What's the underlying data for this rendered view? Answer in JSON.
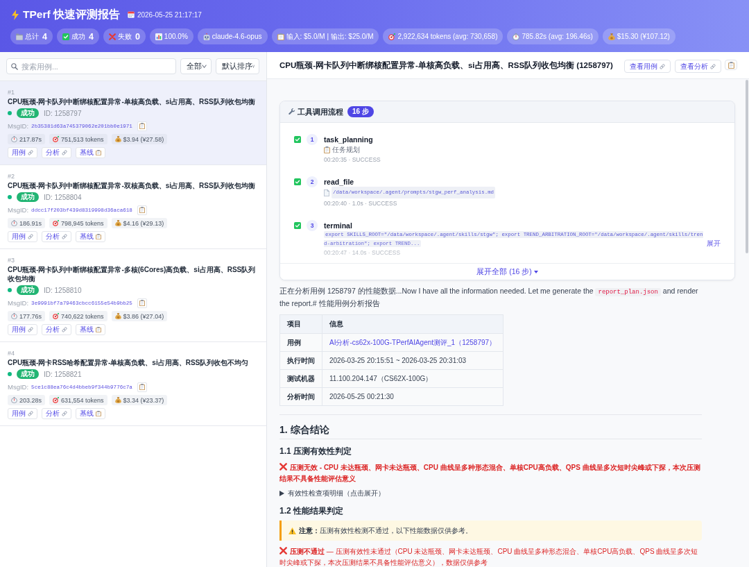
{
  "header": {
    "title": "TPerf 快速评测报告",
    "timestamp": "2026-05-25 21:17:17",
    "stats": [
      {
        "kind": "total",
        "label": "总计",
        "value": "4"
      },
      {
        "kind": "success",
        "label": "成功",
        "value": "4"
      },
      {
        "kind": "failed",
        "label": "失败",
        "value": "0"
      },
      {
        "kind": "rate",
        "label": "100.0%"
      },
      {
        "kind": "model",
        "label": "claude-4.6-opus"
      },
      {
        "kind": "price",
        "label": "输入: $5.0/M | 输出: $25.0/M"
      },
      {
        "kind": "tokens",
        "label": "2,922,634 tokens (avg: 730,658)"
      },
      {
        "kind": "time",
        "label": "785.82s (avg: 196.46s)"
      },
      {
        "kind": "cost",
        "label": "$15.30 (¥107.12)"
      }
    ]
  },
  "sidebar": {
    "search": {
      "placeholder": "搜索用例..."
    },
    "status_filter": {
      "value": "全部"
    },
    "sort": {
      "value": "默认排序"
    },
    "cases": [
      {
        "number": "#1",
        "title": "CPU瓶颈-网卡队列中断绑核配置异常-单核高负载、si占用高、RSS队列收包均衡",
        "selected": true,
        "succeeded": true,
        "status": "成功",
        "id": "ID: 1258797",
        "msg_label": "MsgID:",
        "msg_id": "2b35381d63a745379062e201bb0e1971",
        "duration": "217.87s",
        "tokens": "751,513 tokens",
        "cost": "$3.94 (¥27.58)",
        "links": [
          {
            "kind": "link",
            "label": "用例"
          },
          {
            "kind": "link",
            "label": "分析"
          },
          {
            "kind": "baseline",
            "label": "基线"
          }
        ]
      },
      {
        "number": "#2",
        "title": "CPU瓶颈-网卡队列中断绑核配置异常-双核高负载、si占用高、RSS队列收包均衡",
        "selected": false,
        "succeeded": true,
        "status": "成功",
        "id": "ID: 1258804",
        "msg_label": "MsgID:",
        "msg_id": "ddcc17f203bf439d8319998d36aca618",
        "duration": "186.91s",
        "tokens": "798,945 tokens",
        "cost": "$4.16 (¥29.13)",
        "links": [
          {
            "kind": "link",
            "label": "用例"
          },
          {
            "kind": "link",
            "label": "分析"
          },
          {
            "kind": "baseline",
            "label": "基线"
          }
        ]
      },
      {
        "number": "#3",
        "title": "CPU瓶颈-网卡队列中断绑核配置异常-多核(6Cores)高负载、si占用高、RSS队列收包均衡",
        "selected": false,
        "succeeded": true,
        "status": "成功",
        "id": "ID: 1258810",
        "msg_label": "MsgID:",
        "msg_id": "3e9991bf7a79463cbcc6155e54b9bb25",
        "duration": "177.76s",
        "tokens": "740,622 tokens",
        "cost": "$3.86 (¥27.04)",
        "links": [
          {
            "kind": "link",
            "label": "用例"
          },
          {
            "kind": "link",
            "label": "分析"
          },
          {
            "kind": "baseline",
            "label": "基线"
          }
        ]
      },
      {
        "number": "#4",
        "title": "CPU瓶颈-网卡RSS哈希配置异常-单核高负载、si占用高、RSS队列收包不均匀",
        "selected": false,
        "succeeded": true,
        "status": "成功",
        "id": "ID: 1258821",
        "msg_label": "MsgID:",
        "msg_id": "5ce1c88ea76c4d4bbeb9f344b9776c7a",
        "duration": "203.28s",
        "tokens": "631,554 tokens",
        "cost": "$3.34 (¥23.37)",
        "links": [
          {
            "kind": "link",
            "label": "用例"
          },
          {
            "kind": "link",
            "label": "分析"
          },
          {
            "kind": "baseline",
            "label": "基线"
          }
        ]
      }
    ]
  },
  "detail": {
    "title": "CPU瓶颈-网卡队列中断绑核配置异常-单核高负载、si占用高、RSS队列收包均衡 (1258797)",
    "actions": [
      {
        "kind": "link",
        "label": "查看用例"
      },
      {
        "kind": "link",
        "label": "查看分析"
      },
      {
        "kind": "copy"
      }
    ],
    "tool_flow": {
      "title": "工具调用流程",
      "step_count": "16 步",
      "steps": [
        {
          "kind": "note",
          "number": "1",
          "name": "task_planning",
          "succeeded": true,
          "detail": "任务规划",
          "meta": "00:20:35 · SUCCESS"
        },
        {
          "kind": "file",
          "number": "2",
          "name": "read_file",
          "succeeded": true,
          "detail": "/data/workspace/.agent/prompts/stgw_perf_analysis.md",
          "meta": "00:20:40 · 1.0s · SUCCESS"
        },
        {
          "kind": "command",
          "number": "3",
          "name": "terminal",
          "succeeded": true,
          "detail": "export SKILLS_ROOT=\"/data/workspace/.agent/skills/stgw\"; export TREND_ARBITRATION_ROOT=\"/data/workspace/.agent/skills/trend-arbitration\"; export TREND...",
          "expand": "展开",
          "meta": "00:20:47 · 14.0s · SUCCESS"
        }
      ],
      "expand_all": "展开全部 (16 步)"
    },
    "intro": [
      {
        "kind": "text",
        "text": "正在分析用例 1258797 的性能数据...Now I have all the information needed. Let me generate the "
      },
      {
        "kind": "code",
        "text": "report_plan.json"
      },
      {
        "kind": "text",
        "text": " and render the report.# 性能用例分析报告"
      }
    ],
    "info_table": {
      "columns": [
        "项目",
        "信息"
      ],
      "rows": [
        {
          "kind": "link",
          "label": "用例",
          "value": "AI分析-cs62x-100G-TPerfAIAgent测评_1（1258797）"
        },
        {
          "kind": "text",
          "label": "执行时间",
          "value": "2026-03-25 20:15:51 ~ 2026-03-25 20:31:03"
        },
        {
          "kind": "text",
          "label": "测试机器",
          "value": "11.100.204.147（CS62X-100G）"
        },
        {
          "kind": "text",
          "label": "分析时间",
          "value": "2026-05-25 00:21:30"
        }
      ]
    },
    "report": [
      {
        "kind": "heading",
        "text": "1. 综合结论"
      },
      {
        "kind": "subheading",
        "text": "1.1 压测有效性判定"
      },
      {
        "kind": "verdict",
        "passed": false,
        "text": "压测无效 - CPU 未达瓶颈、网卡未达瓶颈、CPU 曲线呈多种形态混合、单核CPU高负载、QPS 曲线呈多次短时尖峰或下探，本次压测结果不具备性能评估意义"
      },
      {
        "kind": "details",
        "expanded": false,
        "text": "有效性检查项明细（点击展开）"
      },
      {
        "kind": "subheading",
        "text": "1.2 性能结果判定"
      },
      {
        "kind": "note",
        "text": "**注意：**压测有效性检测不通过，以下性能数据仅供参考。"
      },
      {
        "kind": "result",
        "passed": false,
        "text": "**压测不通过** — 压测有效性未通过（CPU 未达瓶颈、网卡未达瓶颈、CPU 曲线呈多种形态混合、单核CPU高负载、QPS 曲线呈多次短时尖峰或下探，本次压测结果不具备性能评估意义），数据仅供参考"
      }
    ]
  }
}
